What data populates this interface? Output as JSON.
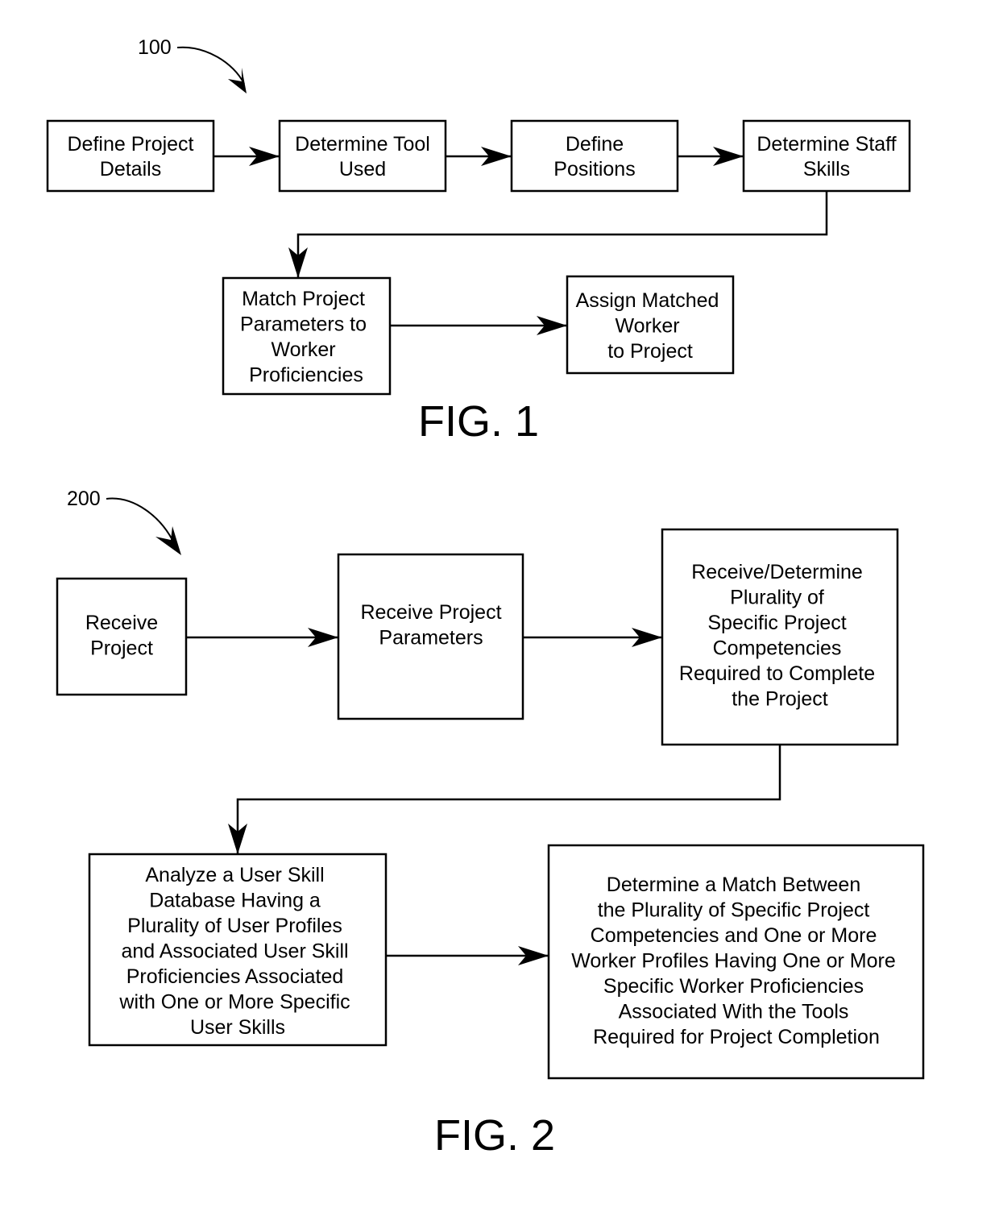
{
  "figures": [
    {
      "reference_numeral": "100",
      "label": "FIG. 1",
      "steps": [
        {
          "id": "define-project-details",
          "lines": [
            "Define Project",
            "Details"
          ]
        },
        {
          "id": "determine-tool-used",
          "lines": [
            "Determine Tool",
            "Used"
          ]
        },
        {
          "id": "define-positions",
          "lines": [
            "Define",
            "Positions"
          ]
        },
        {
          "id": "determine-staff-skills",
          "lines": [
            "Determine Staff",
            "Skills"
          ]
        },
        {
          "id": "match-project-parameters",
          "lines": [
            "Match Project",
            "Parameters to",
            "Worker",
            "Proficiencies"
          ]
        },
        {
          "id": "assign-matched-worker",
          "lines": [
            "Assign Matched",
            "Worker",
            "to Project"
          ]
        }
      ],
      "connections": [
        [
          "define-project-details",
          "determine-tool-used"
        ],
        [
          "determine-tool-used",
          "define-positions"
        ],
        [
          "define-positions",
          "determine-staff-skills"
        ],
        [
          "determine-staff-skills",
          "match-project-parameters"
        ],
        [
          "match-project-parameters",
          "assign-matched-worker"
        ]
      ]
    },
    {
      "reference_numeral": "200",
      "label": "FIG. 2",
      "steps": [
        {
          "id": "receive-project",
          "lines": [
            "Receive",
            "Project"
          ]
        },
        {
          "id": "receive-project-parameters",
          "lines": [
            "Receive Project",
            "Parameters"
          ]
        },
        {
          "id": "determine-competencies",
          "lines": [
            "Receive/Determine",
            "Plurality of",
            "Specific Project",
            "Competencies",
            "Required to Complete",
            "the Project"
          ]
        },
        {
          "id": "analyze-user-skill-database",
          "lines": [
            "Analyze a User Skill",
            "Database Having a",
            "Plurality of User Profiles",
            "and Associated User Skill",
            "Proficiencies Associated",
            "with One or More Specific",
            "User Skills"
          ]
        },
        {
          "id": "determine-match",
          "lines": [
            "Determine a Match Between",
            "the Plurality of Specific Project",
            "Competencies and One or More",
            "Worker Profiles Having One or More",
            "Specific Worker Proficiencies",
            "Associated With the Tools",
            "Required for Project Completion"
          ]
        }
      ],
      "connections": [
        [
          "receive-project",
          "receive-project-parameters"
        ],
        [
          "receive-project-parameters",
          "determine-competencies"
        ],
        [
          "determine-competencies",
          "analyze-user-skill-database"
        ],
        [
          "analyze-user-skill-database",
          "determine-match"
        ]
      ]
    }
  ]
}
